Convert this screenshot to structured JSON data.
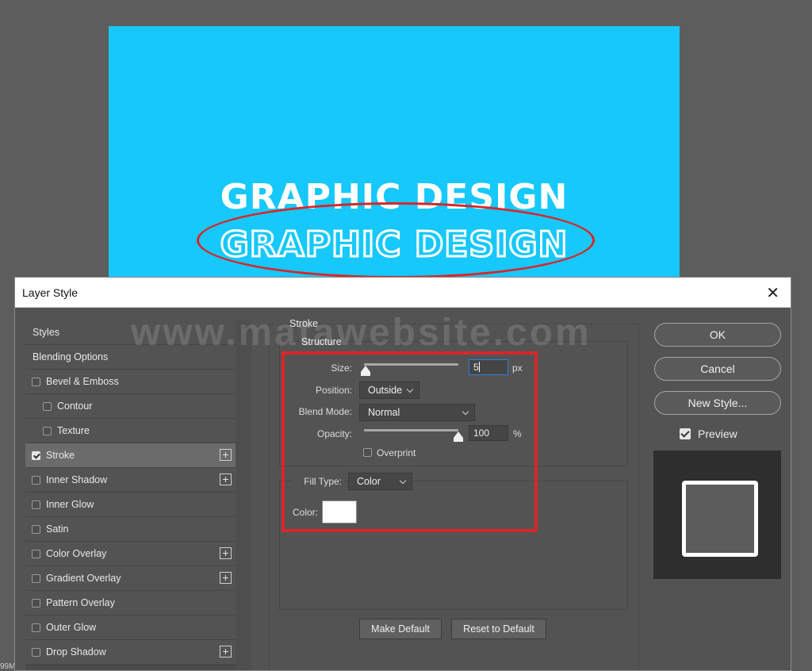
{
  "artwork": {
    "line1": "GRAPHIC DESIGN",
    "line2": "GRAPHIC DESIGN",
    "background_color": "#16c8fb"
  },
  "dialog": {
    "title": "Layer Style",
    "close_glyph": "✕"
  },
  "styles_list": {
    "items": [
      {
        "label": "Styles",
        "checkbox": false,
        "checked": false,
        "sub": false,
        "plus": false,
        "selected": false
      },
      {
        "label": "Blending Options",
        "checkbox": false,
        "checked": false,
        "sub": false,
        "plus": false,
        "selected": false
      },
      {
        "label": "Bevel & Emboss",
        "checkbox": true,
        "checked": false,
        "sub": false,
        "plus": false,
        "selected": false
      },
      {
        "label": "Contour",
        "checkbox": true,
        "checked": false,
        "sub": true,
        "plus": false,
        "selected": false
      },
      {
        "label": "Texture",
        "checkbox": true,
        "checked": false,
        "sub": true,
        "plus": false,
        "selected": false
      },
      {
        "label": "Stroke",
        "checkbox": true,
        "checked": true,
        "sub": false,
        "plus": true,
        "selected": true
      },
      {
        "label": "Inner Shadow",
        "checkbox": true,
        "checked": false,
        "sub": false,
        "plus": true,
        "selected": false
      },
      {
        "label": "Inner Glow",
        "checkbox": true,
        "checked": false,
        "sub": false,
        "plus": false,
        "selected": false
      },
      {
        "label": "Satin",
        "checkbox": true,
        "checked": false,
        "sub": false,
        "plus": false,
        "selected": false
      },
      {
        "label": "Color Overlay",
        "checkbox": true,
        "checked": false,
        "sub": false,
        "plus": true,
        "selected": false
      },
      {
        "label": "Gradient Overlay",
        "checkbox": true,
        "checked": false,
        "sub": false,
        "plus": true,
        "selected": false
      },
      {
        "label": "Pattern Overlay",
        "checkbox": true,
        "checked": false,
        "sub": false,
        "plus": false,
        "selected": false
      },
      {
        "label": "Outer Glow",
        "checkbox": true,
        "checked": false,
        "sub": false,
        "plus": false,
        "selected": false
      },
      {
        "label": "Drop Shadow",
        "checkbox": true,
        "checked": false,
        "sub": false,
        "plus": true,
        "selected": false
      }
    ]
  },
  "stroke": {
    "section_title": "Stroke",
    "structure_title": "Structure",
    "size_label": "Size:",
    "size_value": "5",
    "size_unit": "px",
    "size_slider_fraction": 0.02,
    "position_label": "Position:",
    "position_value": "Outside",
    "blend_label": "Blend Mode:",
    "blend_value": "Normal",
    "opacity_label": "Opacity:",
    "opacity_value": "100",
    "opacity_unit": "%",
    "opacity_slider_fraction": 1.0,
    "overprint_label": "Overprint",
    "fill_type_label": "Fill Type:",
    "fill_type_value": "Color",
    "color_label": "Color:",
    "color_value": "#ffffff",
    "make_default": "Make Default",
    "reset_default": "Reset to Default"
  },
  "actions": {
    "ok": "OK",
    "cancel": "Cancel",
    "new_style": "New Style...",
    "preview_label": "Preview"
  },
  "watermark": "www.matawebsite.com",
  "status": "99M",
  "colors": {
    "annotation": "#d8262b",
    "focus": "#2f7de1"
  }
}
